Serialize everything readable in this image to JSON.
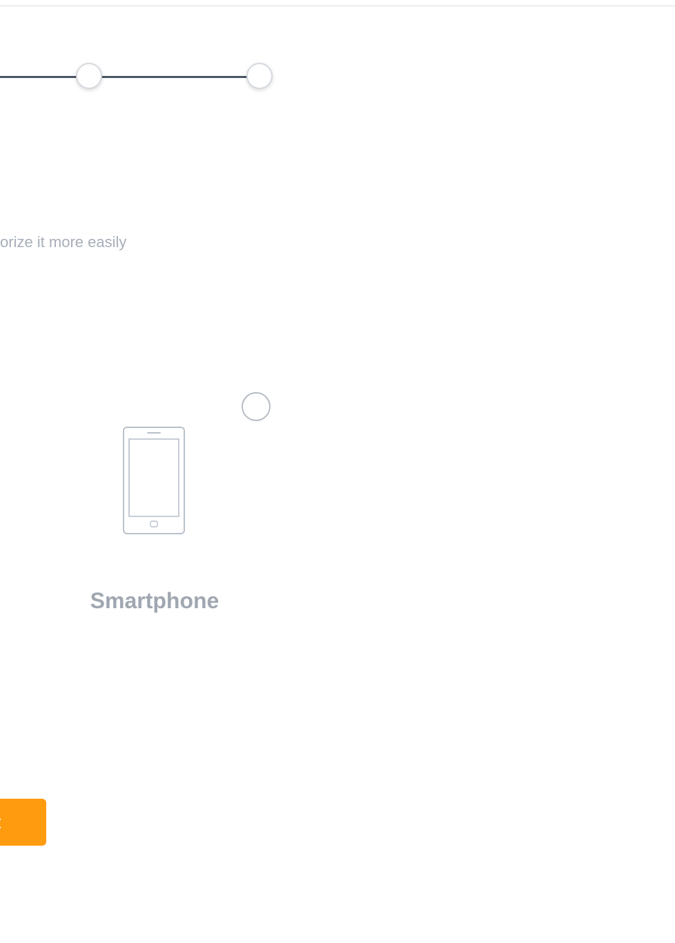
{
  "stepper": {
    "nodes": [
      "step-2",
      "step-3"
    ],
    "line_color": "#4b5563"
  },
  "form": {
    "subtitle_fragment": "orize it more easily"
  },
  "device_option": {
    "icon": "smartphone-icon",
    "label": "Smartphone",
    "selected": false
  },
  "footer": {
    "button_label": "t",
    "button_color": "#ff9b0f"
  }
}
